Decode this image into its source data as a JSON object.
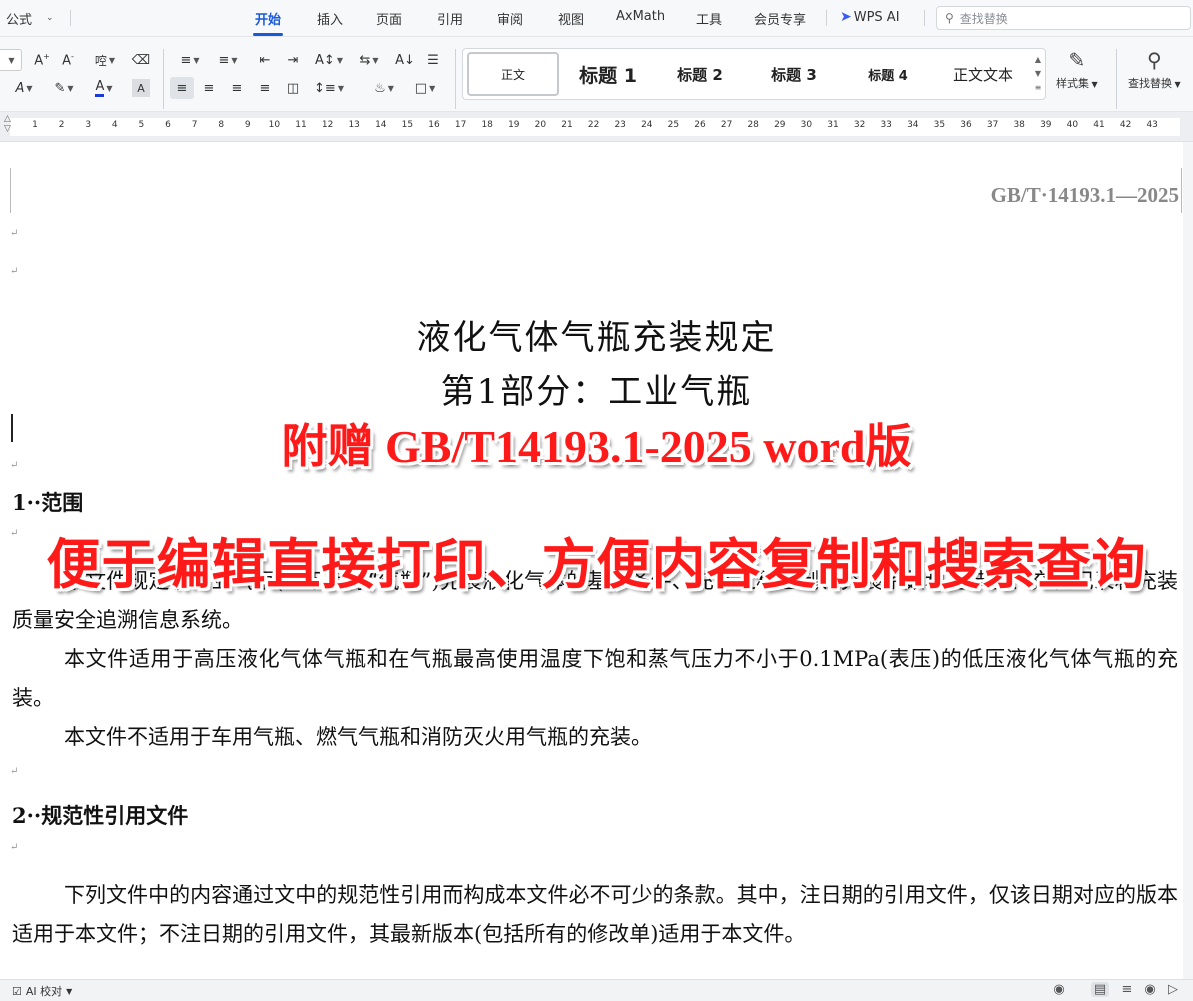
{
  "menubar": {
    "formula_label": "公式",
    "tabs": [
      {
        "label": "开始",
        "active": true
      },
      {
        "label": "插入"
      },
      {
        "label": "页面"
      },
      {
        "label": "引用"
      },
      {
        "label": "审阅"
      },
      {
        "label": "视图"
      },
      {
        "label": "AxMath"
      },
      {
        "label": "工具"
      },
      {
        "label": "会员专享"
      }
    ],
    "wps_ai_label": "WPS AI",
    "search_placeholder": "查找替换",
    "accent_color": "#1a5ad6"
  },
  "ribbon": {
    "styles": [
      {
        "label": "正文",
        "selected": true
      },
      {
        "label": "标题 1"
      },
      {
        "label": "标题 2"
      },
      {
        "label": "标题 3"
      },
      {
        "label": "标题 4"
      },
      {
        "label": "正文文本"
      }
    ],
    "styles_set_label": "样式集",
    "find_replace_label": "查找替换"
  },
  "ruler": {
    "numbers": [
      "1",
      "2",
      "3",
      "4",
      "5",
      "6",
      "7",
      "8",
      "9",
      "10",
      "11",
      "12",
      "13",
      "14",
      "15",
      "16",
      "17",
      "18",
      "19",
      "20",
      "21",
      "22",
      "23",
      "24",
      "25",
      "26",
      "27",
      "28",
      "29",
      "30",
      "31",
      "32",
      "33",
      "34",
      "35",
      "36",
      "37",
      "38",
      "39",
      "40",
      "41",
      "42",
      "43"
    ]
  },
  "document": {
    "standard_number": "GB/T·14193.1—2025",
    "title_line1": "液化气体气瓶充装规定",
    "title_line2": "第1部分：工业气瓶",
    "section1_heading": "1··范围",
    "para1": "本文件规定了工业气瓶(以下简称“气瓶”)充装液化气体的基本条件、充装过程控制、充装系数和充装量、充装记录和充装质量安全追溯信息系统。",
    "para2": "本文件适用于高压液化气体气瓶和在气瓶最高使用温度下饱和蒸气压力不小于0.1MPa(表压)的低压液化气体气瓶的充装。",
    "para3": "本文件不适用于车用气瓶、燃气气瓶和消防灭火用气瓶的充装。",
    "section2_heading": "2··规范性引用文件",
    "para4": "下列文件中的内容通过文中的规范性引用而构成本文件必不可少的条款。其中，注日期的引用文件，仅该日期对应的版本适用于本文件；不注日期的引用文件，其最新版本(包括所有的修改单)适用于本文件。"
  },
  "overlay": {
    "line1": "附赠 GB/T14193.1-2025 word版",
    "line2": "便于编辑直接打印、方便内容复制和搜索查询",
    "color": "#ff1a1a"
  },
  "statusbar": {
    "ai_label": "AI 校对"
  }
}
